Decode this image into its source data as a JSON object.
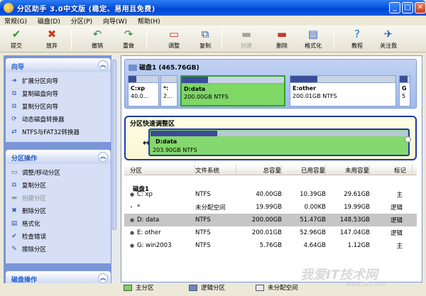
{
  "window": {
    "title": "分区助手 3.0中文版 (稳定、易用且免费)",
    "btn_min": "_",
    "btn_max": "□",
    "btn_close": "✕"
  },
  "menu": [
    "常规(G)",
    "磁盘(D)",
    "分区(P)",
    "向导(W)",
    "帮助(H)"
  ],
  "toolbar": [
    {
      "label": "提交",
      "icon": "check-icon",
      "glyph": "✔",
      "color": "#2d9c2d",
      "enabled": true
    },
    {
      "label": "放弃",
      "icon": "discard-icon",
      "glyph": "✖",
      "color": "#d23b1e",
      "enabled": true
    },
    {
      "label": "撤销",
      "icon": "undo-icon",
      "glyph": "↶",
      "color": "#2a8f3a",
      "enabled": true
    },
    {
      "label": "重做",
      "icon": "redo-icon",
      "glyph": "↷",
      "color": "#2a8f3a",
      "enabled": true
    },
    {
      "label": "调整",
      "icon": "resize-partition-icon",
      "glyph": "▭",
      "color": "#c0392b",
      "enabled": true
    },
    {
      "label": "复制",
      "icon": "copy-partition-icon",
      "glyph": "⧉",
      "color": "#2c5bb7",
      "enabled": true
    },
    {
      "label": "创建",
      "icon": "create-partition-icon",
      "glyph": "▬",
      "color": "#a5a297",
      "enabled": false
    },
    {
      "label": "删除",
      "icon": "delete-partition-icon",
      "glyph": "▬",
      "color": "#c0392b",
      "enabled": true
    },
    {
      "label": "格式化",
      "icon": "format-icon",
      "glyph": "▤",
      "color": "#2c5bb7",
      "enabled": true
    },
    {
      "label": "教程",
      "icon": "help-icon",
      "glyph": "?",
      "color": "#1d6bd1",
      "enabled": true
    },
    {
      "label": "关注我",
      "icon": "follow-icon",
      "glyph": "✈",
      "color": "#2c5bb7",
      "enabled": true
    }
  ],
  "sidebar": {
    "wizard": {
      "title": "向导",
      "items": [
        {
          "label": "扩展分区向导",
          "enabled": true
        },
        {
          "label": "复制磁盘向导",
          "enabled": true
        },
        {
          "label": "复制分区向导",
          "enabled": true
        },
        {
          "label": "动态磁盘转换器",
          "enabled": true
        },
        {
          "label": "NTFS与FAT32转换器",
          "enabled": true
        }
      ]
    },
    "partition_ops": {
      "title": "分区操作",
      "items": [
        {
          "label": "调整/移动分区",
          "enabled": true
        },
        {
          "label": "复制分区",
          "enabled": true
        },
        {
          "label": "创建分区",
          "enabled": false
        },
        {
          "label": "删除分区",
          "enabled": true
        },
        {
          "label": "格式化",
          "enabled": true
        },
        {
          "label": "检查错误",
          "enabled": true
        },
        {
          "label": "擦除分区",
          "enabled": true
        }
      ]
    },
    "disk_ops": {
      "title": "磁盘操作"
    }
  },
  "disk_map": {
    "title": "磁盘1 (465.76GB)",
    "partitions": [
      {
        "name": "C:xp",
        "size": "40.0...",
        "used_fraction": 0.26,
        "fill_color": "#3b4d9a",
        "selected": false
      },
      {
        "name": "*:",
        "size": "2...",
        "used_fraction": 0,
        "fill_color": "#3b4d9a",
        "selected": false
      },
      {
        "name": "D:data",
        "size": "200.00GB NTFS",
        "used_fraction": 0.26,
        "fill_color": "#3b4d9a",
        "selected": true
      },
      {
        "name": "E:other",
        "size": "200.01GB NTFS",
        "used_fraction": 0.26,
        "fill_color": "#3b4d9a",
        "selected": false
      },
      {
        "name": "G",
        "size": "5",
        "used_fraction": 0.8,
        "fill_color": "#3b4d9a",
        "selected": false
      }
    ]
  },
  "quick_resize": {
    "title": "分区快速调整区",
    "name": "D:data",
    "size": "203.90GB NTFS",
    "used_fraction": 0.26
  },
  "table": {
    "headers": [
      "分区",
      "文件系统",
      "总容量",
      "已用容量",
      "未用容量",
      "标记"
    ],
    "disk_label": "磁盘1",
    "rows": [
      {
        "partition": "C:  xp",
        "fs": "NTFS",
        "total": "40.00GB",
        "used": "10.39GB",
        "free": "29.61GB",
        "flag": "主",
        "selected": false
      },
      {
        "partition": "*",
        "fs": "未分配空间",
        "total": "19.99GB",
        "used": "0.00KB",
        "free": "19.99GB",
        "flag": "逻辑",
        "selected": false
      },
      {
        "partition": "D:  data",
        "fs": "NTFS",
        "total": "200.00GB",
        "used": "51.47GB",
        "free": "148.53GB",
        "flag": "逻辑",
        "selected": true
      },
      {
        "partition": "E:  other",
        "fs": "NTFS",
        "total": "200.01GB",
        "used": "52.96GB",
        "free": "147.04GB",
        "flag": "逻辑",
        "selected": false
      },
      {
        "partition": "G:  win2003",
        "fs": "NTFS",
        "total": "5.76GB",
        "used": "4.64GB",
        "free": "1.12GB",
        "flag": "主",
        "selected": false
      }
    ]
  },
  "legend": [
    {
      "label": "主分区",
      "color": "#7ed460"
    },
    {
      "label": "逻辑分区",
      "color": "#6f84c7"
    },
    {
      "label": "未分配空间",
      "color": "#ececec"
    }
  ],
  "watermark": {
    "text": "我爱IT技术网",
    "url": "www.52ij.com"
  }
}
